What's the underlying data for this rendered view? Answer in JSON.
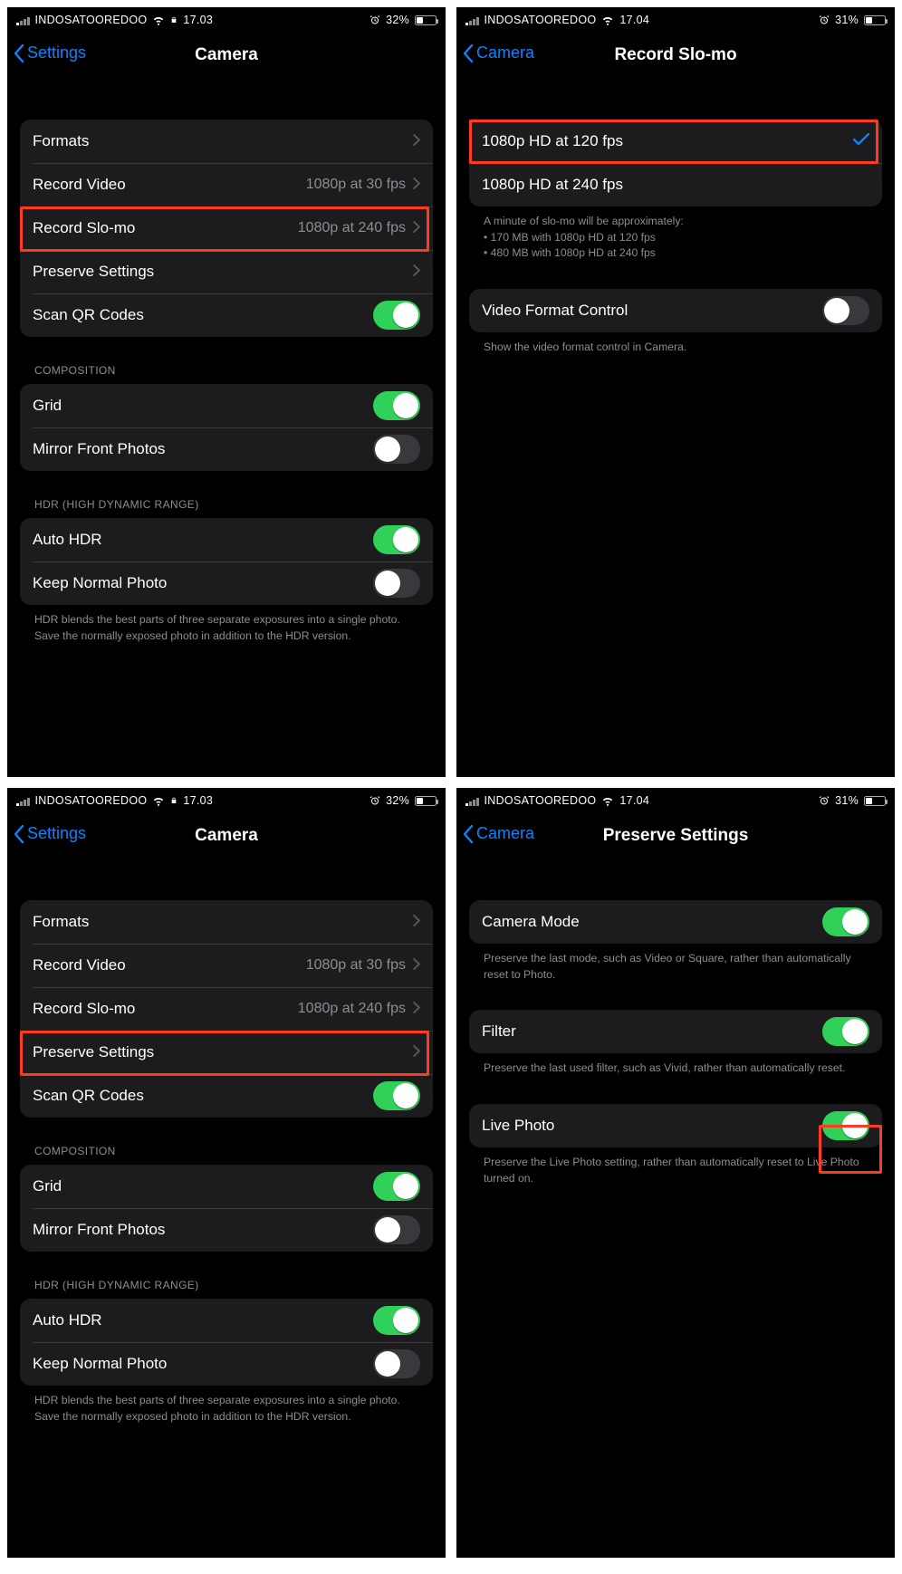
{
  "status": {
    "carrier": "INDOSATOOREDOO",
    "t1": "17.03",
    "t2": "17.04",
    "b1": "32%",
    "b2": "31%"
  },
  "camA": {
    "back": "Settings",
    "title": "Camera",
    "formats": "Formats",
    "recVideo": "Record Video",
    "recVideoVal": "1080p at 30 fps",
    "recSlo": "Record Slo-mo",
    "recSloVal": "1080p at 240 fps",
    "preserve": "Preserve Settings",
    "scanQR": "Scan QR Codes",
    "compHdr": "COMPOSITION",
    "grid": "Grid",
    "mirror": "Mirror Front Photos",
    "hdrHdr": "HDR (HIGH DYNAMIC RANGE)",
    "autoHdr": "Auto HDR",
    "keepNormal": "Keep Normal Photo",
    "hdrNote": "HDR blends the best parts of three separate exposures into a single photo. Save the normally exposed photo in addition to the HDR version."
  },
  "slo": {
    "back": "Camera",
    "title": "Record Slo-mo",
    "opt120": "1080p HD at 120 fps",
    "opt240": "1080p HD at 240 fps",
    "note1": "A minute of slo-mo will be approximately:",
    "note2": "• 170 MB with 1080p HD at 120 fps",
    "note3": "• 480 MB with 1080p HD at 240 fps",
    "vfc": "Video Format Control",
    "vfcNote": "Show the video format control in Camera."
  },
  "pres": {
    "back": "Camera",
    "title": "Preserve Settings",
    "camMode": "Camera Mode",
    "camModeNote": "Preserve the last mode, such as Video or Square, rather than automatically reset to Photo.",
    "filter": "Filter",
    "filterNote": "Preserve the last used filter, such as Vivid, rather than automatically reset.",
    "live": "Live Photo",
    "liveNote": "Preserve the Live Photo setting, rather than automatically reset to Live Photo turned on."
  }
}
